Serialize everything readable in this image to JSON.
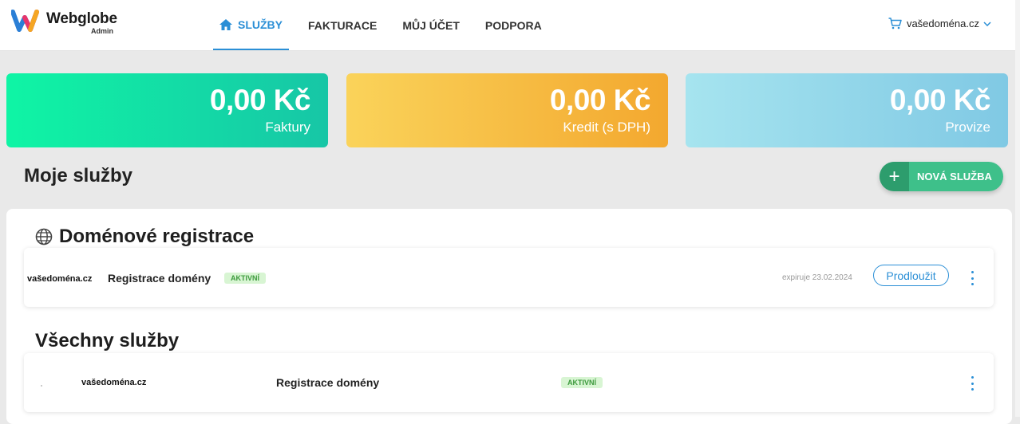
{
  "brand": {
    "name": "Webglobe",
    "sub": "Admin",
    "colors": {
      "accent": "#2b8fd6",
      "green": "#3ec08a"
    }
  },
  "nav": {
    "items": [
      {
        "label": "SLUŽBY",
        "icon": "home-icon",
        "active": true
      },
      {
        "label": "FAKTURACE"
      },
      {
        "label": "MŮJ ÚČET"
      },
      {
        "label": "PODPORA"
      }
    ]
  },
  "cart": {
    "icon": "cart-icon",
    "domain": "vašedoména.cz"
  },
  "stats": [
    {
      "amount": "0,00 Kč",
      "label": "Faktury"
    },
    {
      "amount": "0,00 Kč",
      "label": "Kredit (s DPH)"
    },
    {
      "amount": "0,00 Kč",
      "label": "Provize"
    }
  ],
  "page": {
    "title": "Moje služby",
    "new_service_label": "NOVÁ SLUŽBA"
  },
  "domains": {
    "title": "Doménové registrace",
    "row": {
      "domain": "vašedoména.cz",
      "service": "Registrace domény",
      "status": "AKTIVNÍ",
      "expiry": "expiruje 23.02.2024",
      "renew_label": "Prodloužit"
    }
  },
  "all_services": {
    "title": "Všechny služby",
    "row": {
      "domain": "vašedoména.cz",
      "service": "Registrace domény",
      "status": "AKTIVNÍ"
    }
  }
}
